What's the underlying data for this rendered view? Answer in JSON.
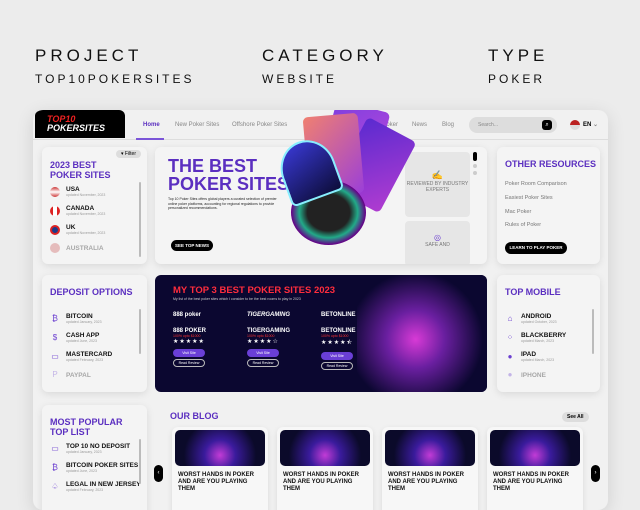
{
  "meta": {
    "project_label": "PROJECT",
    "project_value": "TOP10POKERSITES",
    "category_label": "CATEGORY",
    "category_value": "WEBSITE",
    "type_label": "TYPE",
    "type_value": "POKER"
  },
  "header": {
    "logo_top": "TOP10",
    "logo_bottom": "POKERSITES",
    "nav": [
      "Home",
      "New Poker Sites",
      "Offshore Poker Sites",
      "Mobile Poker",
      "News",
      "Blog"
    ],
    "search_placeholder": "Search...",
    "language": "EN"
  },
  "best_sites": {
    "filter": "Filter",
    "title": "2023 BEST POKER SITES",
    "items": [
      {
        "name": "USA",
        "updated": "updated November, 2023"
      },
      {
        "name": "CANADA",
        "updated": "updated November, 2023"
      },
      {
        "name": "UK",
        "updated": "updated November, 2023"
      },
      {
        "name": "AUSTRALIA",
        "updated": "updated November, 2023"
      }
    ]
  },
  "hero": {
    "title_line1": "THE BEST",
    "title_line2": "POKER SITES",
    "description": "Top 10 Poker Sites offers global players a curated selection of premier online poker platforms, accounting for regional regulations to provide personalized recommendations.",
    "cta": "SEE TOP NEWS",
    "feature1": "REVIEWED BY INDUSTRY EXPERTS",
    "feature2": "SAFE AND"
  },
  "other_resources": {
    "title": "OTHER RESOURCES",
    "links": [
      "Poker Room Comparison",
      "Easiest Poker Sites",
      "Mac Poker",
      "Rules of Poker"
    ],
    "cta": "LEARN TO PLAY POKER"
  },
  "deposit": {
    "title": "DEPOSIT OPTIONS",
    "items": [
      {
        "name": "BITCOIN",
        "updated": "updated January, 2023"
      },
      {
        "name": "CASH APP",
        "updated": "updated June, 2023"
      },
      {
        "name": "MASTERCARD",
        "updated": "updated February, 2023"
      },
      {
        "name": "PAYPAL",
        "updated": ""
      }
    ]
  },
  "top3": {
    "title": "MY TOP 3 BEST POKER SITES 2023",
    "subtitle": "My list of the best poker sites which I consider to be the best rooms to play in 2023",
    "operators": [
      {
        "brand": "888 poker",
        "name": "888 POKER",
        "bonus": "100% upto $1000",
        "rating": 5,
        "stars": "★★★★★"
      },
      {
        "brand": "TIGERGAMING",
        "name": "TIGERGAMING",
        "bonus": "100% upto $1000",
        "rating": 4,
        "stars": "★★★★☆"
      },
      {
        "brand": "BETONLINE",
        "name": "BETONLINE",
        "bonus": "100% upto $1000",
        "rating": 4.5,
        "stars": "★★★★⯪"
      }
    ],
    "visit": "Visit Site",
    "review": "Read Review"
  },
  "mobile": {
    "title": "TOP MOBILE",
    "items": [
      {
        "name": "ANDROID",
        "updated": "updated October, 2023"
      },
      {
        "name": "BLACKBERRY",
        "updated": "updated March, 2023"
      },
      {
        "name": "IPAD",
        "updated": "updated March, 2023"
      },
      {
        "name": "IPHONE",
        "updated": ""
      }
    ]
  },
  "popular": {
    "title": "MOST POPULAR TOP LIST",
    "items": [
      {
        "name": "TOP 10 NO DEPOSIT",
        "updated": "updated January, 2023"
      },
      {
        "name": "BITCOIN POKER SITES",
        "updated": "updated June, 2023"
      },
      {
        "name": "LEGAL IN NEW JERSEY",
        "updated": "updated February, 2023"
      }
    ]
  },
  "blog": {
    "title": "OUR BLOG",
    "see_all": "See All",
    "posts": [
      "WORST HANDS IN POKER AND ARE YOU PLAYING THEM",
      "WORST HANDS IN POKER AND ARE YOU PLAYING THEM",
      "WORST HANDS IN POKER AND ARE YOU PLAYING THEM",
      "WORST HANDS IN POKER AND ARE YOU PLAYING THEM"
    ]
  }
}
